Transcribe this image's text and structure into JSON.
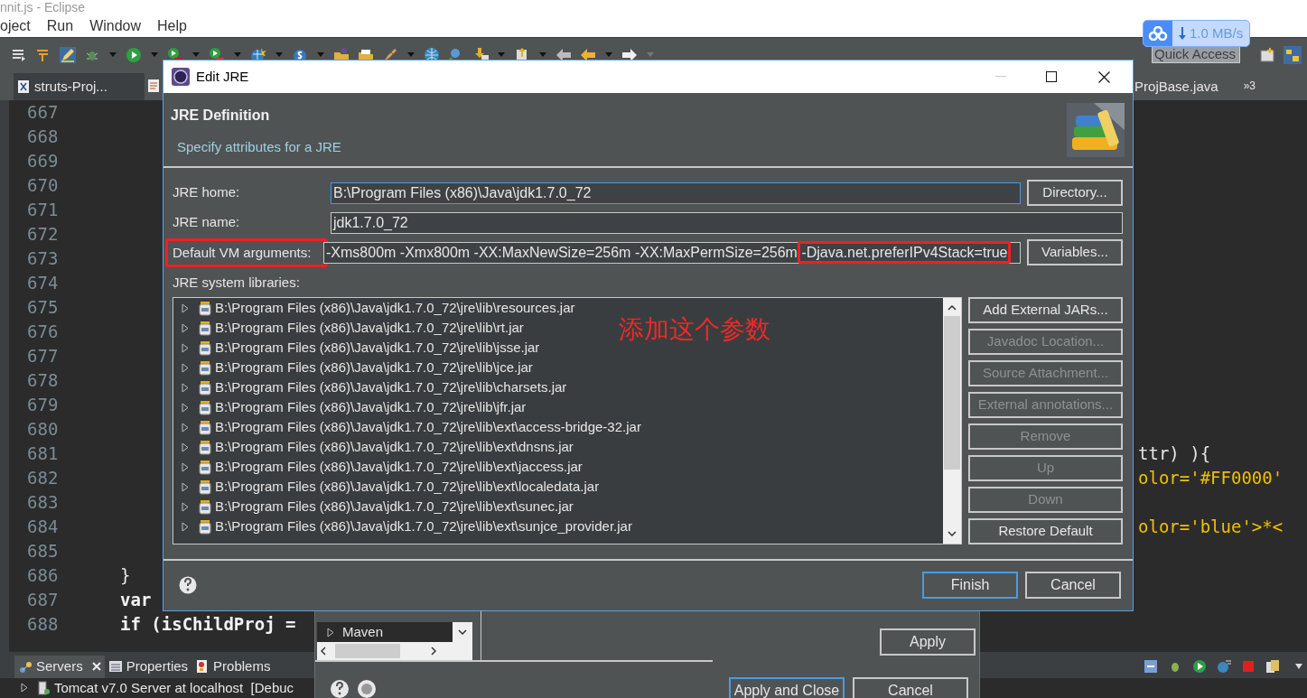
{
  "window": {
    "title": "nnit.js - Eclipse"
  },
  "menu": [
    "oject",
    "Run",
    "Window",
    "Help"
  ],
  "download_widget": {
    "speed": "1.0 MB/s"
  },
  "quick_access": {
    "placeholder": "Quick Access"
  },
  "editor_tabs": [
    {
      "label": "struts-Proj...",
      "selected": true
    },
    {
      "label": "ProjBase.java",
      "selected": false
    }
  ],
  "editor_tab_overflow": "»3",
  "editor": {
    "lines": [
      {
        "number": "667"
      },
      {
        "number": "668"
      },
      {
        "number": "669"
      },
      {
        "number": "670"
      },
      {
        "number": "671"
      },
      {
        "number": "672"
      },
      {
        "number": "673"
      },
      {
        "number": "674"
      },
      {
        "number": "675"
      },
      {
        "number": "676"
      },
      {
        "number": "677"
      },
      {
        "number": "678"
      },
      {
        "number": "679"
      },
      {
        "number": "680"
      },
      {
        "number": "681",
        "right": {
          "text": "ttr) ){",
          "kind": "plain"
        }
      },
      {
        "number": "682",
        "right": {
          "text": "olor='#FF0000'",
          "kind": "string"
        }
      },
      {
        "number": "683"
      },
      {
        "number": "684",
        "right": {
          "text": "olor='blue'>*<",
          "kind": "string"
        }
      },
      {
        "number": "685"
      },
      {
        "number": "686",
        "left": {
          "text": "}",
          "kind": "plain"
        }
      },
      {
        "number": "687",
        "left": {
          "text": "var",
          "kind": "keyword"
        }
      },
      {
        "number": "688",
        "left": {
          "text": "if (isChildProj =",
          "kind": "keyword"
        }
      }
    ]
  },
  "preferences_dialog": {
    "tree_items": [
      "Maven"
    ],
    "apply": "Apply",
    "buttons": [
      "Apply and Close",
      "Cancel"
    ]
  },
  "bottom_panel": {
    "tabs": [
      {
        "label": "Servers",
        "closable": true,
        "selected": true
      },
      {
        "label": "Properties",
        "closable": false,
        "selected": false
      },
      {
        "label": "Problems",
        "closable": false,
        "selected": false
      }
    ],
    "servers": [
      "Tomcat v7.0 Server at localhost  [Debuc"
    ]
  },
  "dialog": {
    "title": "Edit JRE",
    "heading": "JRE Definition",
    "description": "Specify attributes for a JRE",
    "fields": [
      {
        "label": "JRE home:",
        "value": [
          {
            "text": "B:\\Program Files (x86)\\Java\\jdk1.7.0_72",
            "highlighted": false
          }
        ],
        "button": "Directory...",
        "focused": true,
        "highlighted": false
      },
      {
        "label": "JRE name:",
        "value": [
          {
            "text": "jdk1.7.0_72",
            "highlighted": false
          }
        ],
        "focused": false,
        "highlighted": false
      },
      {
        "label": "Default VM arguments:",
        "value": [
          {
            "text": "-Xms800m -Xmx800m -XX:MaxNewSize=256m -XX:MaxPermSize=256m ",
            "highlighted": false
          },
          {
            "text": "-Djava.net.preferIPv4Stack=true",
            "highlighted": true
          }
        ],
        "button": "Variables...",
        "focused": false,
        "highlighted": true
      }
    ],
    "libraries_label": "JRE system libraries:",
    "libraries": [
      "B:\\Program Files (x86)\\Java\\jdk1.7.0_72\\jre\\lib\\resources.jar",
      "B:\\Program Files (x86)\\Java\\jdk1.7.0_72\\jre\\lib\\rt.jar",
      "B:\\Program Files (x86)\\Java\\jdk1.7.0_72\\jre\\lib\\jsse.jar",
      "B:\\Program Files (x86)\\Java\\jdk1.7.0_72\\jre\\lib\\jce.jar",
      "B:\\Program Files (x86)\\Java\\jdk1.7.0_72\\jre\\lib\\charsets.jar",
      "B:\\Program Files (x86)\\Java\\jdk1.7.0_72\\jre\\lib\\jfr.jar",
      "B:\\Program Files (x86)\\Java\\jdk1.7.0_72\\jre\\lib\\ext\\access-bridge-32.jar",
      "B:\\Program Files (x86)\\Java\\jdk1.7.0_72\\jre\\lib\\ext\\dnsns.jar",
      "B:\\Program Files (x86)\\Java\\jdk1.7.0_72\\jre\\lib\\ext\\jaccess.jar",
      "B:\\Program Files (x86)\\Java\\jdk1.7.0_72\\jre\\lib\\ext\\localedata.jar",
      "B:\\Program Files (x86)\\Java\\jdk1.7.0_72\\jre\\lib\\ext\\sunec.jar",
      "B:\\Program Files (x86)\\Java\\jdk1.7.0_72\\jre\\lib\\ext\\sunjce_provider.jar"
    ],
    "annotation": "添加这个参数",
    "side_buttons": [
      {
        "label": "Add External JARs...",
        "disabled": false
      },
      {
        "label": "Javadoc Location...",
        "disabled": true
      },
      {
        "label": "Source Attachment...",
        "disabled": true
      },
      {
        "label": "External annotations...",
        "disabled": true
      },
      {
        "label": "Remove",
        "disabled": true
      },
      {
        "label": "Up",
        "disabled": true
      },
      {
        "label": "Down",
        "disabled": true
      },
      {
        "label": "Restore Default",
        "disabled": false
      }
    ],
    "buttons": [
      {
        "label": "Finish",
        "default": true
      },
      {
        "label": "Cancel",
        "default": false
      }
    ]
  }
}
